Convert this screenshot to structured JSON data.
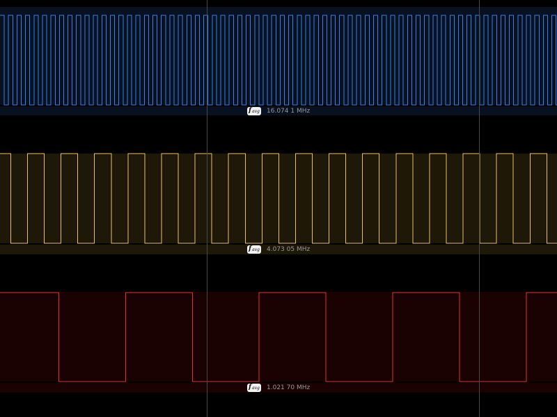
{
  "channels": [
    {
      "id": "ch1",
      "color": "#3a7fe8",
      "band_color": "#07111f",
      "measurement": {
        "label": "f",
        "subscript": "avg",
        "value": "16.074 1 MHz"
      },
      "frequency_mhz": 16.0741
    },
    {
      "id": "ch2",
      "color": "#f0c060",
      "band_color": "#1d1808",
      "measurement": {
        "label": "f",
        "subscript": "avg",
        "value": "4.073 05 MHz"
      },
      "frequency_mhz": 4.07305
    },
    {
      "id": "ch3",
      "color": "#e03030",
      "band_color": "#1a0202",
      "measurement": {
        "label": "f",
        "subscript": "avg",
        "value": "1.021 70 MHz"
      },
      "frequency_mhz": 1.0217
    }
  ],
  "cursors": {
    "color": "#4a4a4a",
    "count": 2
  }
}
